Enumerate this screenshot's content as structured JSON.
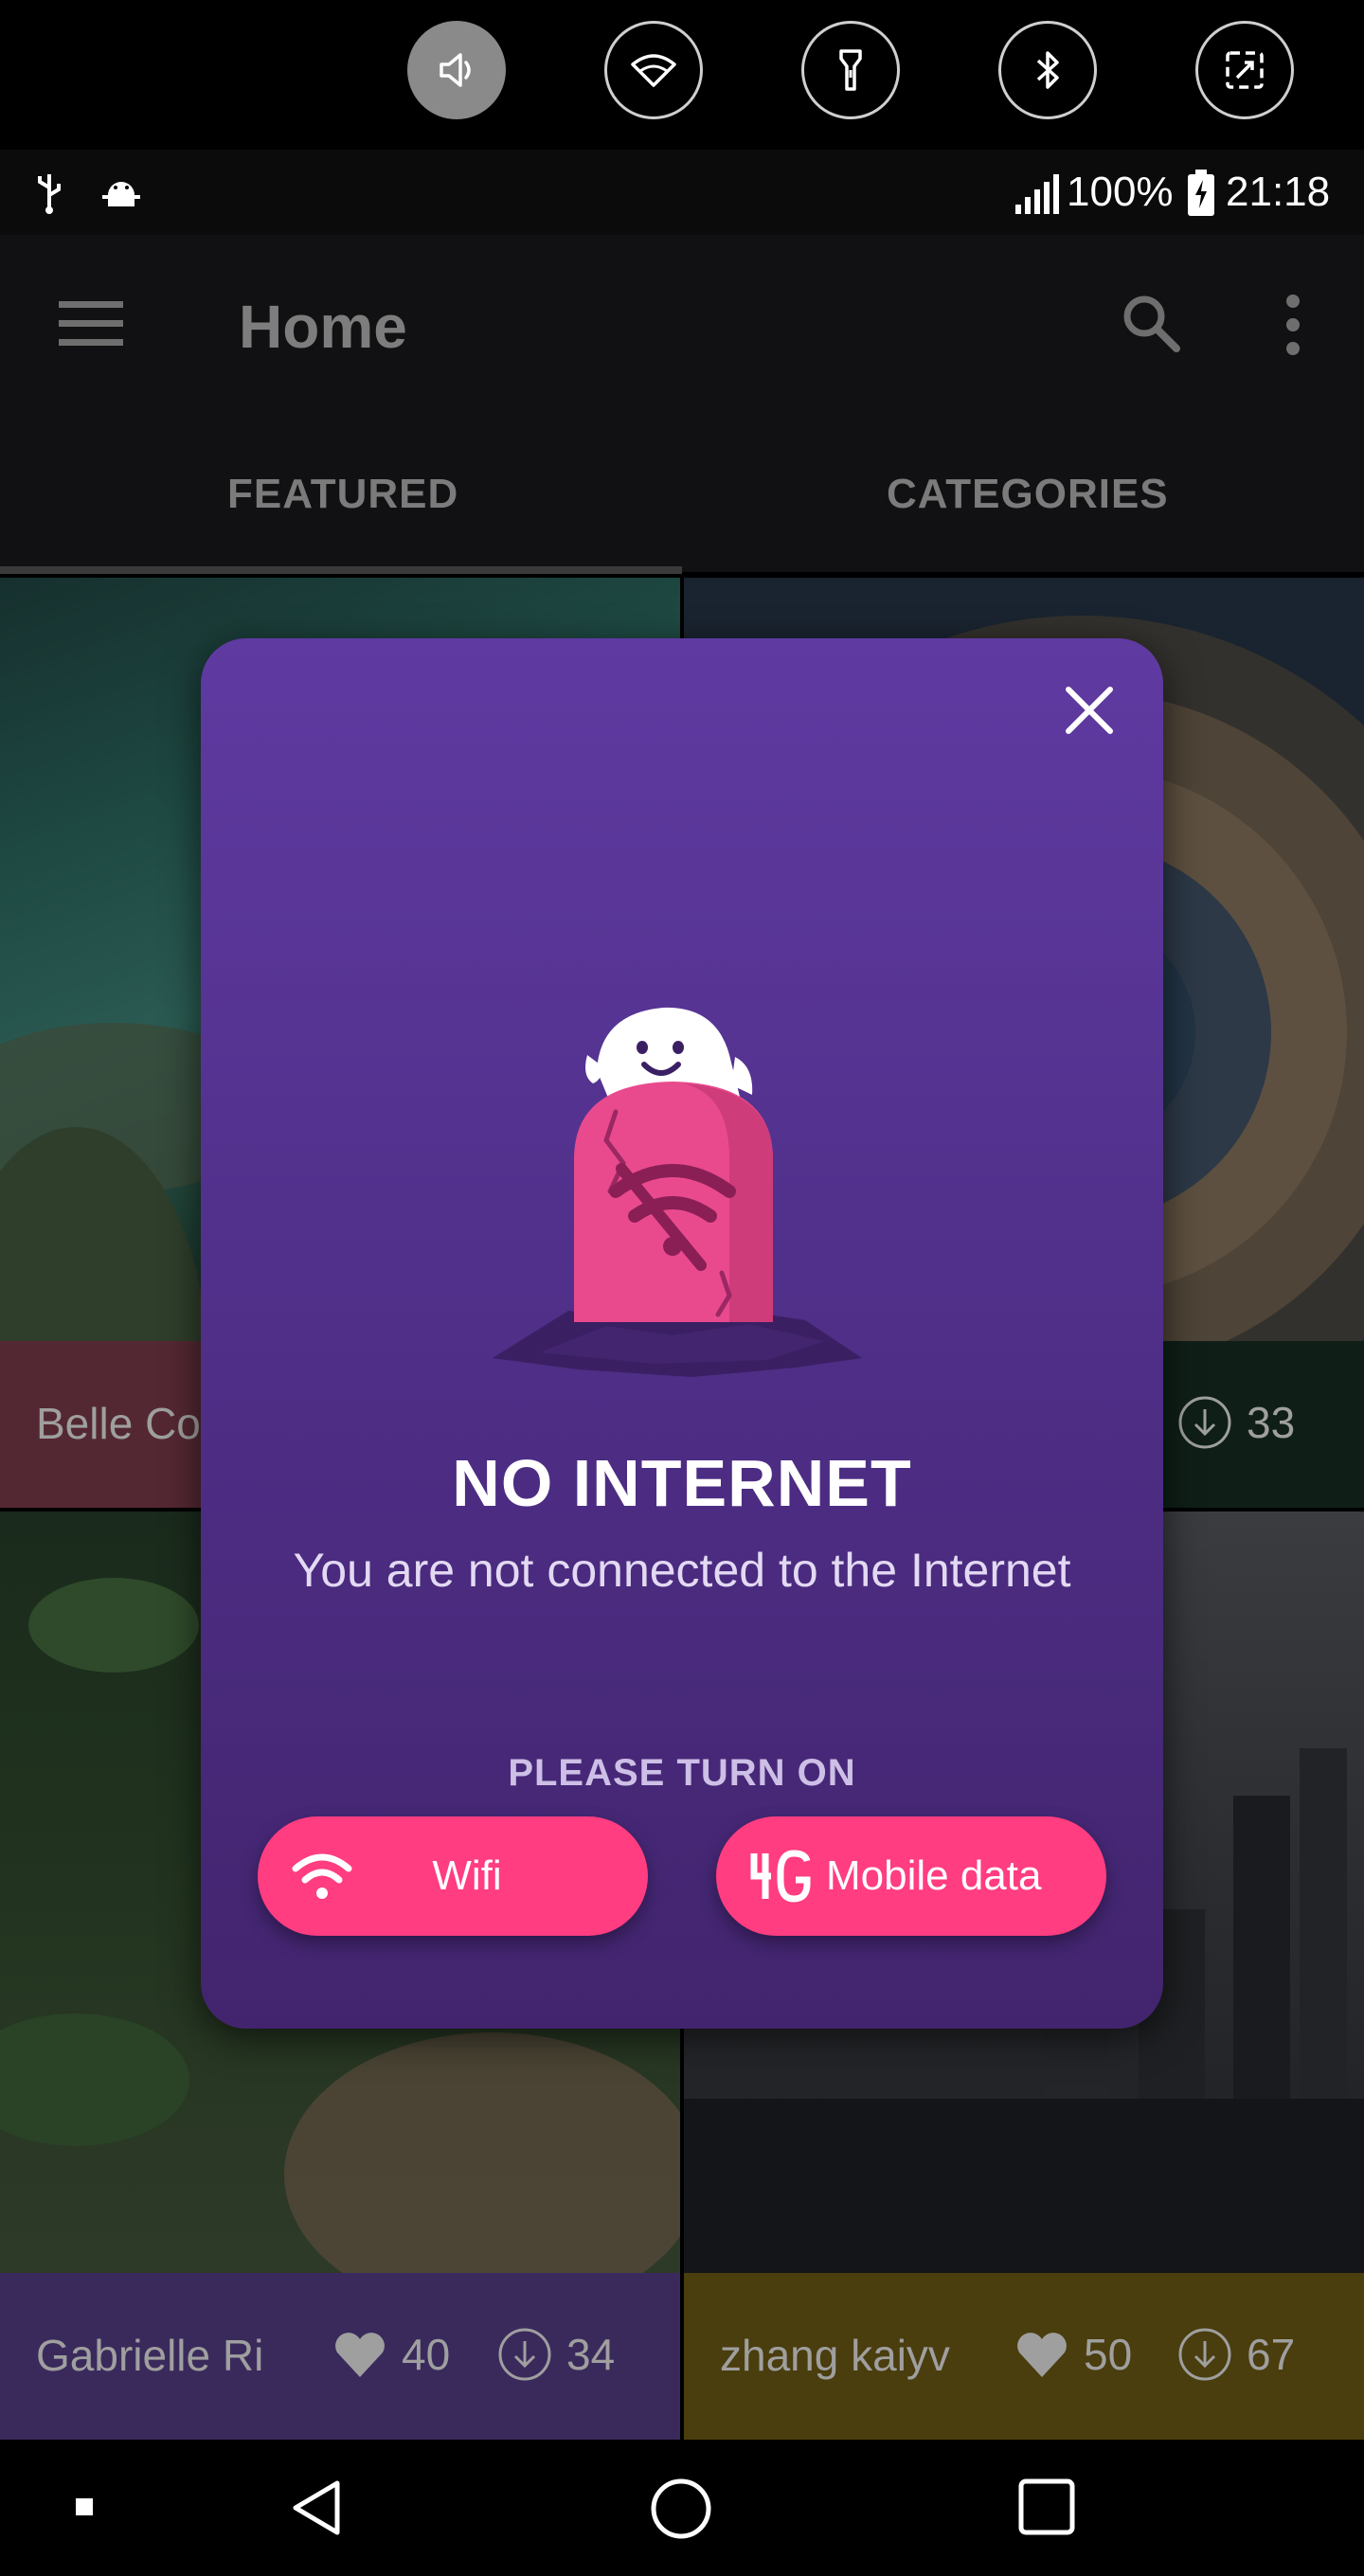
{
  "quick_settings": {
    "icons": [
      "volume-icon",
      "wifi-icon",
      "flashlight-icon",
      "bluetooth-icon",
      "screen-rotation-icon"
    ]
  },
  "status_bar": {
    "battery": "100%",
    "time": "21:18"
  },
  "app_bar": {
    "title": "Home"
  },
  "tabs": [
    {
      "label": "FEATURED",
      "selected": true
    },
    {
      "label": "CATEGORIES",
      "selected": false
    }
  ],
  "cards": [
    {
      "author": "Belle Co",
      "likes": "",
      "downloads": ""
    },
    {
      "author": "",
      "likes": "",
      "downloads": "33"
    },
    {
      "author": "Gabrielle  Ri",
      "likes": "40",
      "downloads": "34"
    },
    {
      "author": "zhang kaiyv",
      "likes": "50",
      "downloads": "67"
    }
  ],
  "dialog": {
    "title": "NO INTERNET",
    "message": "You are not connected to the Internet",
    "prompt": "PLEASE TURN ON",
    "wifi_label": "Wifi",
    "mobile_label": "Mobile data"
  },
  "colors": {
    "dialog_bg": "#5f3aa1",
    "button_pink": "#ff3d80",
    "tombstone_pink": "#e94a8e"
  }
}
